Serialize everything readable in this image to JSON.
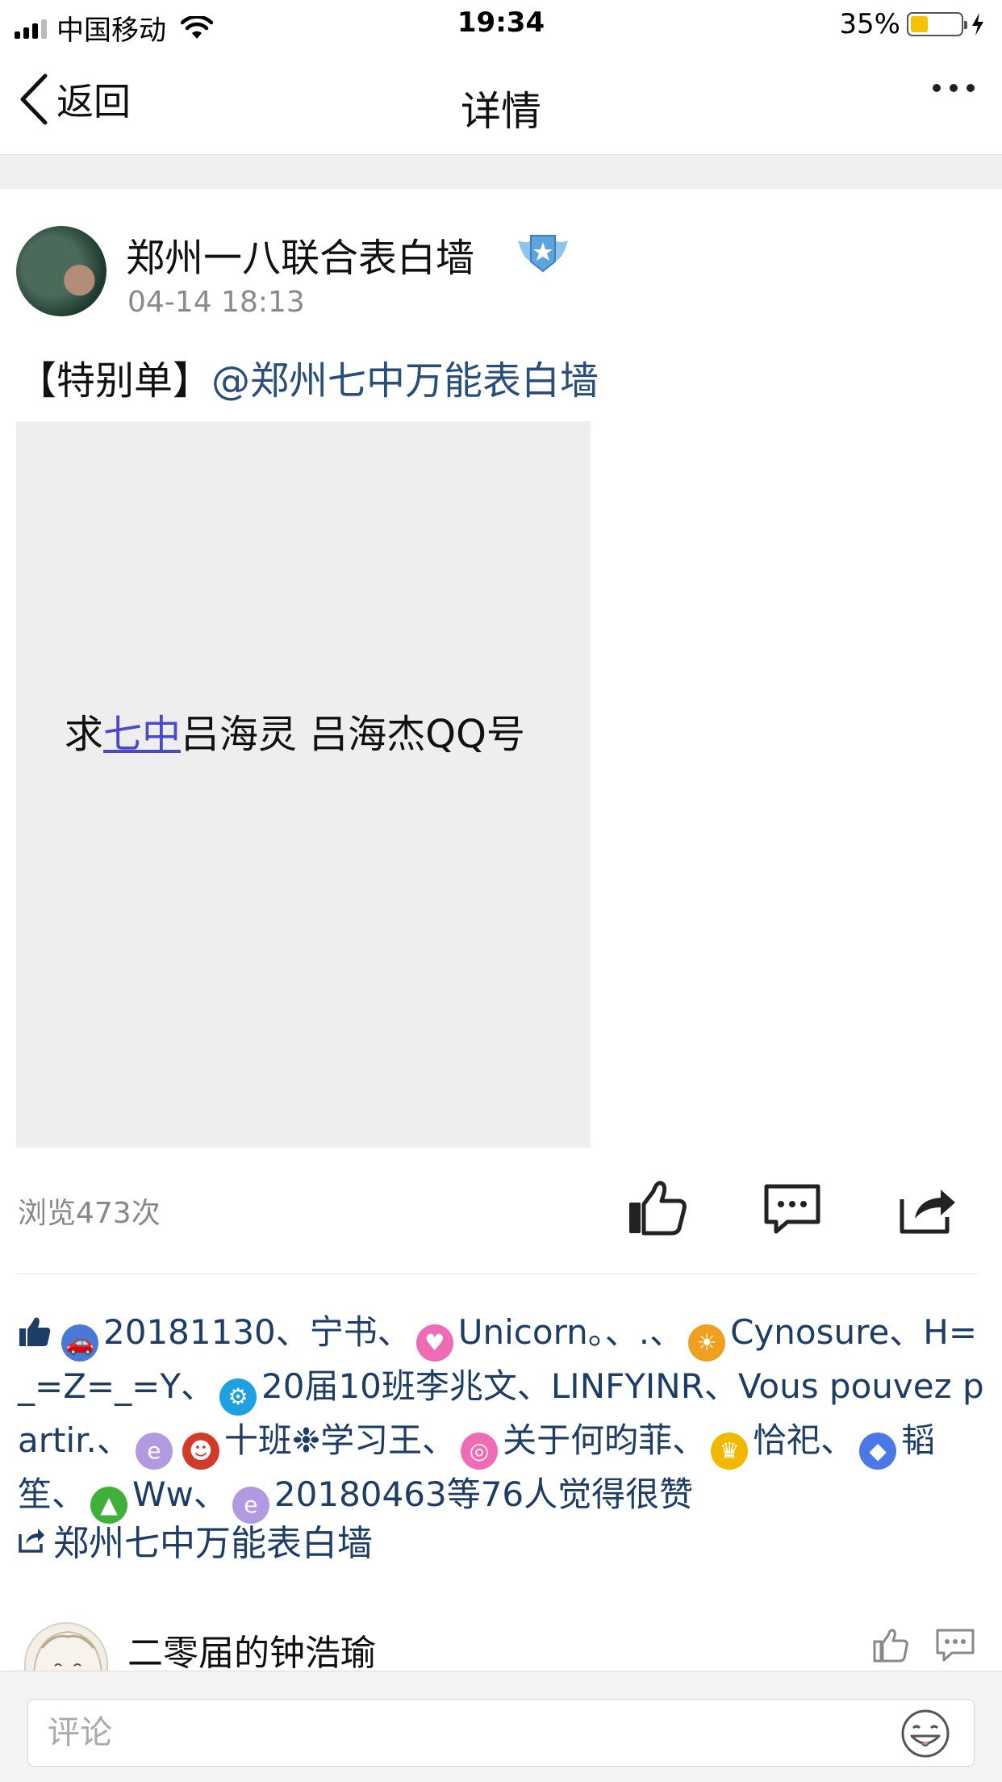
{
  "status_bar": {
    "carrier": "中国移动",
    "time": "19:34",
    "battery": "35%",
    "battery_level": 0.35
  },
  "nav": {
    "back_label": "返回",
    "title": "详情"
  },
  "post": {
    "author": "郑州一八联合表白墙",
    "time": "04-14 18:13",
    "tag": "【特别单】",
    "mention": "@郑州七中万能表白墙",
    "image_text": {
      "before": "求",
      "link": "七中",
      "after": "吕海灵 吕海杰QQ号"
    },
    "views": "浏览473次"
  },
  "likers": {
    "segments": [
      {
        "icon": "car-icon",
        "color": "#4a78d6",
        "text": "20181130、宁书、"
      },
      {
        "icon": "heart-icon",
        "color": "#f06bb6",
        "text": "Unicorn。、.、"
      },
      {
        "icon": "sun-icon",
        "color": "#f0a020",
        "text": "Cynosure、H=_=Z=_=Y、"
      },
      {
        "icon": "gear-icon",
        "color": "#1ea1e0",
        "text": "20届10班李兆文、LINFYINR、Vous pouvez partir.、"
      },
      {
        "icon": "e-icon",
        "color": "#b399e0",
        "text": ""
      },
      {
        "icon": "mask-icon",
        "color": "#d23a2a",
        "text": "十班❉学习王、"
      },
      {
        "icon": "lollipop-icon",
        "color": "#f06bb6",
        "text": "关于何昀菲、"
      },
      {
        "icon": "crown-icon",
        "color": "#f2b800",
        "text": "恰祀、"
      },
      {
        "icon": "fish-icon",
        "color": "#4a78e6",
        "text": "韬笙、"
      },
      {
        "icon": "tree-icon",
        "color": "#3fb03c",
        "text": "Ww、"
      },
      {
        "icon": "e-icon",
        "color": "#b399e0",
        "text": "20180463"
      }
    ],
    "suffix": "等76人觉得很赞"
  },
  "repost": {
    "label": "郑州七中万能表白墙"
  },
  "comment_preview": {
    "name": "二零届的钟浩瑜"
  },
  "comment_bar": {
    "placeholder": "评论"
  }
}
